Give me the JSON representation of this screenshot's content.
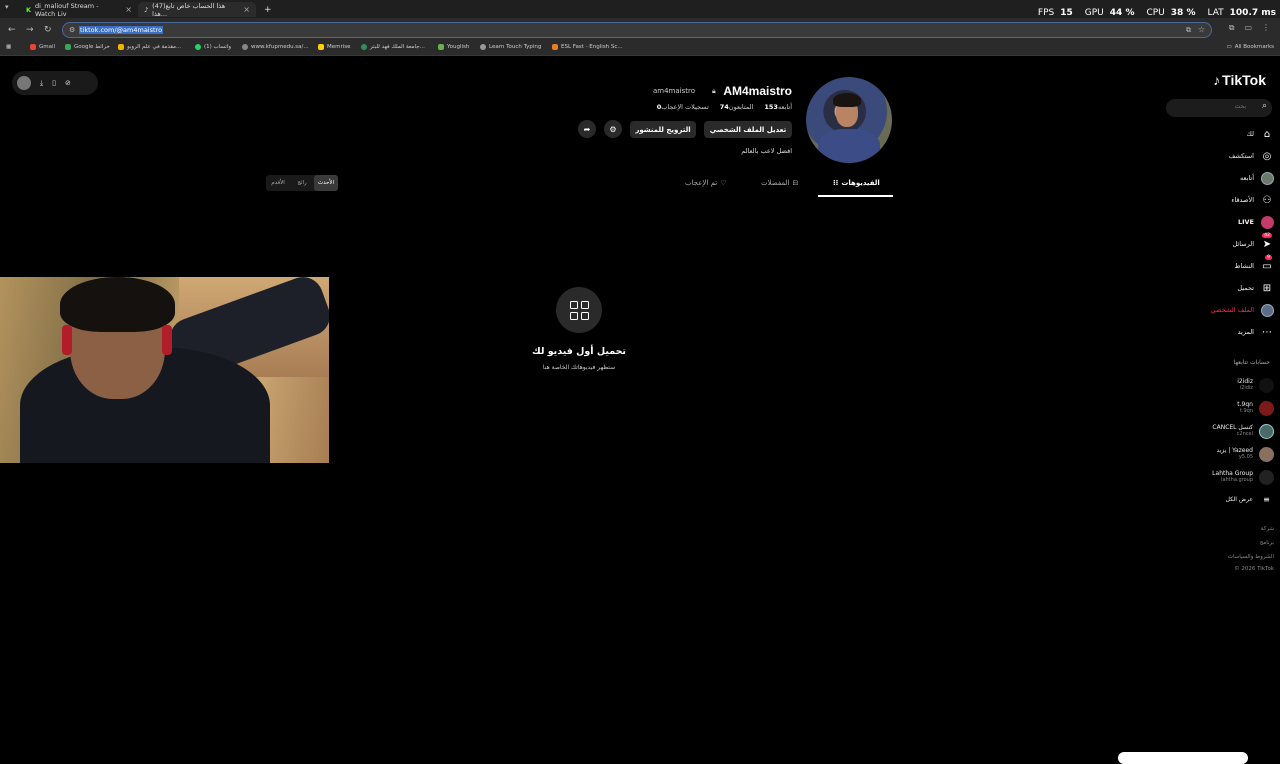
{
  "browser": {
    "tabs": [
      {
        "label": "di_maliouf Stream - Watch Liv"
      },
      {
        "label": "(47)هذا الحساب خاص تابع هذا..."
      }
    ],
    "new_tab": "+",
    "url": "tiktok.com/@am4maistro",
    "stats": {
      "fps_label": "FPS",
      "fps": "15",
      "gpu_label": "GPU",
      "gpu": "44 %",
      "cpu_label": "CPU",
      "cpu": "38 %",
      "lat_label": "LAT",
      "lat": "100.7 ms"
    },
    "bookmarks": [
      {
        "label": "Gmail",
        "color": "#ea4335"
      },
      {
        "label": "Google خرائط",
        "color": "#34a853"
      },
      {
        "label": "مقدمة في علم الروبو...",
        "color": "#f4b400"
      },
      {
        "label": "(1) واتساب",
        "color": "#25d366"
      },
      {
        "label": "www.kfupmedu.sa/...",
        "color": "#888888"
      },
      {
        "label": "Memrise",
        "color": "#ffd000"
      },
      {
        "label": "جامعة الملك فهد للبتر...",
        "color": "#2f8f5f"
      },
      {
        "label": "Youglish",
        "color": "#6ab04c"
      },
      {
        "label": "Learn Touch Typing",
        "color": "#999999"
      },
      {
        "label": "ESL Fast - English Sc...",
        "color": "#e67e22"
      }
    ],
    "all_bookmarks": "All Bookmarks"
  },
  "tiktok": {
    "logo": "TikTok",
    "search_placeholder": "بحث",
    "nav": [
      {
        "label": "لك",
        "icon": "home-icon"
      },
      {
        "label": "استكشف",
        "icon": "compass-icon"
      },
      {
        "label": "أتابعه",
        "icon": "avatar-icon"
      },
      {
        "label": "الأصدقاء",
        "icon": "friends-icon"
      },
      {
        "label": "LIVE",
        "icon": "live-icon"
      },
      {
        "label": "الرسائل",
        "icon": "message-icon",
        "badge": "42"
      },
      {
        "label": "النشاط",
        "icon": "activity-icon",
        "badge": "9"
      },
      {
        "label": "تحميل",
        "icon": "upload-icon"
      },
      {
        "label": "الملف الشخصي",
        "icon": "profile-icon"
      },
      {
        "label": "المزيد",
        "icon": "more-icon"
      }
    ],
    "following_header": "حسابات تتابعها",
    "following": [
      {
        "name": "i2idiz",
        "handle": "i2idiz",
        "color": "#111111"
      },
      {
        "name": "t.9qn",
        "handle": "t.9qn",
        "color": "#7a1a1a"
      },
      {
        "name": "CANCEL كنسل",
        "handle": "c2ncel",
        "color": "#4a6a6a"
      },
      {
        "name": "يزيد | Yazeed",
        "handle": "y5.05",
        "color": "#8a7060"
      },
      {
        "name": "Lahtha Group",
        "handle": "lahtha.group",
        "color": "#222222"
      }
    ],
    "show_all": "عرض الكل",
    "footer": [
      "شركة",
      "برنامج",
      "الشروط والسياسات",
      "© 2026 TikTok"
    ],
    "profile": {
      "username": "AM4maistro",
      "handle": "am4maistro",
      "following_count": "153",
      "following_label": "أتابعه",
      "followers_count": "74",
      "followers_label": "المتابعون",
      "likes_count": "0",
      "likes_label": "تسجيلات الإعجاب",
      "edit_button": "تعديل الملف الشخصي",
      "promote_button": "الترويج للمنشور",
      "bio": "افضل لاعب بالعالم"
    },
    "tabs": [
      {
        "label": "الفيديوهات"
      },
      {
        "label": "المفضلات"
      },
      {
        "label": "تم الإعجاب"
      }
    ],
    "sort": [
      "الأقدم",
      "رائج",
      "الأحدث"
    ],
    "empty_title": "تحميل أول فيديو لك",
    "empty_sub": "ستظهر فيديوهاتك الخاصة هنا"
  }
}
